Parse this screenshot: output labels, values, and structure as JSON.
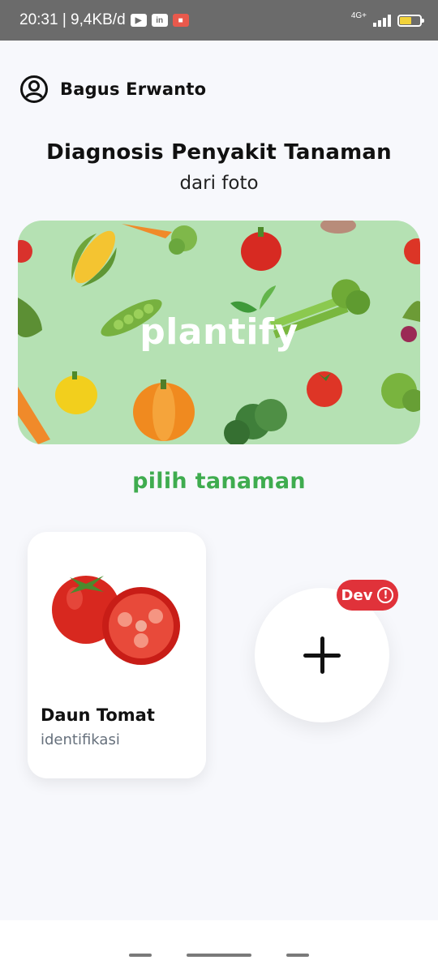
{
  "status_bar": {
    "time_speed": "20:31 | 9,4KB/d",
    "network": "4G+",
    "battery_level": "61",
    "icons": [
      "youtube-icon",
      "linkedin-icon",
      "shop-icon"
    ]
  },
  "header": {
    "user_name": "Bagus Erwanto",
    "title": "Diagnosis Penyakit Tanaman",
    "subtitle": "dari foto"
  },
  "banner": {
    "brand": "plantify"
  },
  "section": {
    "label": "pilih tanaman"
  },
  "plants": [
    {
      "name": "Daun Tomat",
      "subtitle": "identifikasi"
    }
  ],
  "add": {
    "badge": "Dev",
    "badge_icon": "!"
  },
  "colors": {
    "accent": "#3fac4f",
    "badge": "#e0323a",
    "banner_bg": "#b5e1b3"
  }
}
